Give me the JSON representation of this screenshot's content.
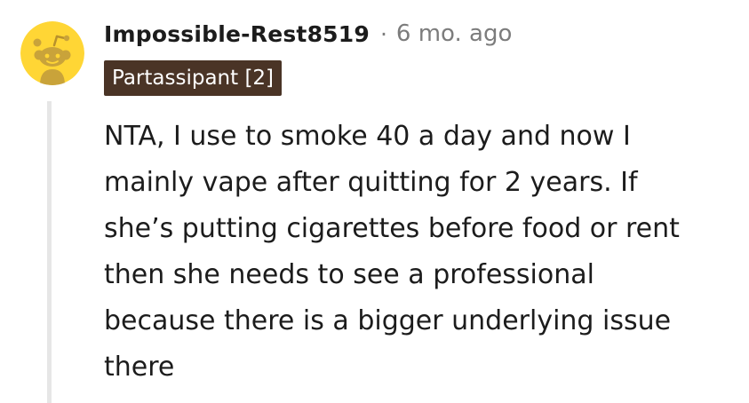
{
  "comment": {
    "username": "Impossible-Rest8519",
    "separator": "·",
    "timestamp": "6 mo. ago",
    "flair": "Partassipant [2]",
    "body_lines": [
      "NTA, I use to smoke 40 a day and now I",
      "mainly vape after quitting for 2 years. If",
      "she’s putting cigarettes before food or rent",
      "then she needs to see a professional",
      "because there is a bigger underlying issue",
      "there"
    ]
  },
  "colors": {
    "avatar_background": "#ffd635",
    "snoo_body": "#c9a33a",
    "flair_background": "#4a3426",
    "username_text": "#1c1c1c",
    "meta_text": "#7c7c7c",
    "thread_line": "#e6e6e6"
  },
  "icons": {
    "avatar": "snoo-avatar-icon"
  }
}
